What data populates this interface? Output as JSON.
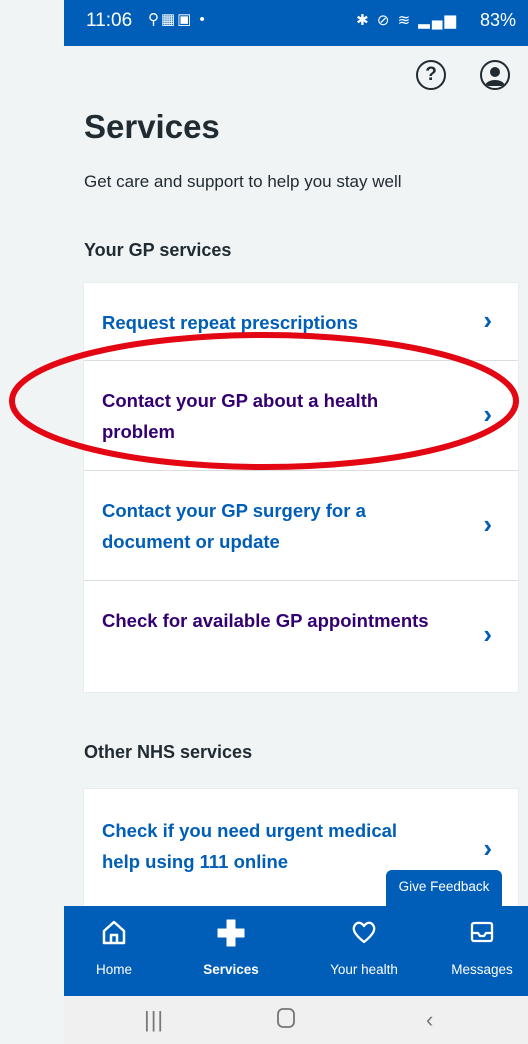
{
  "status_bar": {
    "time": "11:06",
    "battery": "83%"
  },
  "header": {
    "help_icon": "question-circle-icon",
    "account_icon": "account-circle-icon"
  },
  "page": {
    "title": "Services",
    "subtitle": "Get care and support to help you stay well"
  },
  "gp_section": {
    "title": "Your GP services",
    "items": [
      {
        "label": "Request repeat prescriptions",
        "visited": false
      },
      {
        "label": "Contact your GP about a health problem",
        "visited": true,
        "highlighted": true
      },
      {
        "label": "Contact your GP surgery for a document or update",
        "visited": false
      },
      {
        "label": "Check for available GP appointments",
        "visited": true
      }
    ]
  },
  "other_section": {
    "title": "Other NHS services",
    "items": [
      {
        "label": "Check if you need urgent medical help using 111 online",
        "visited": false
      }
    ]
  },
  "feedback_button": "Give Feedback",
  "bottom_nav": {
    "items": [
      {
        "label": "Home",
        "icon": "home-icon"
      },
      {
        "label": "Services",
        "icon": "plus-icon",
        "active": true
      },
      {
        "label": "Your health",
        "icon": "heart-icon"
      },
      {
        "label": "Messages",
        "icon": "inbox-icon"
      }
    ]
  },
  "colors": {
    "nhs_blue": "#005eb8",
    "visited_purple": "#330072",
    "background": "#f0f4f5",
    "annotation_red": "#e30613"
  }
}
